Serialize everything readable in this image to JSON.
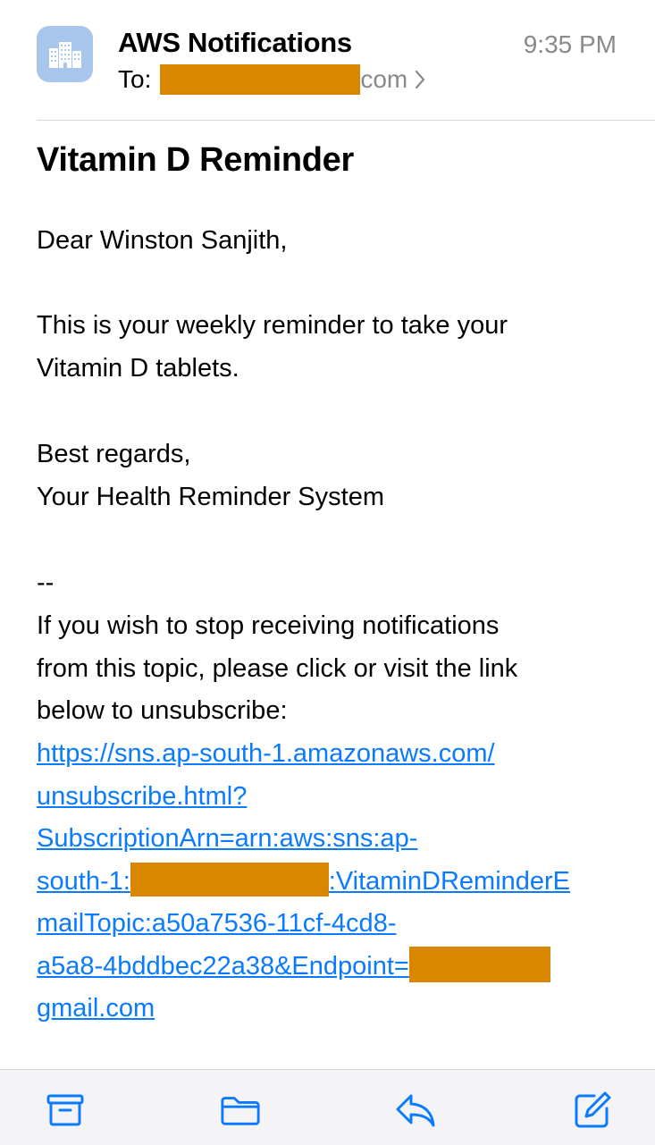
{
  "header": {
    "sender": "AWS Notifications",
    "time": "9:35 PM",
    "to_label": "To:",
    "to_suffix": "com",
    "avatar_icon": "building-icon",
    "redaction_color": "#d98600"
  },
  "email": {
    "subject": "Vitamin D Reminder",
    "greeting": "Dear Winston Sanjith,",
    "paragraph_1_lines": [
      "This is your weekly reminder to take your",
      "Vitamin D tablets."
    ],
    "closing_lines": [
      "Best regards,",
      "Your Health Reminder System"
    ],
    "separator": "--",
    "unsubscribe_lines": [
      "If you wish to stop receiving notifications",
      "from this topic, please click or visit the link",
      "below to unsubscribe:"
    ],
    "link": {
      "line_1": "https://sns.ap-south-1.amazonaws.com/",
      "line_2": "unsubscribe.html?",
      "line_3": "SubscriptionArn=arn:aws:sns:ap-",
      "line_4_start": "south-1:",
      "line_4_end": ":VitaminDReminderE",
      "line_5": "mailTopic:a50a7536-11cf-4cd8-",
      "line_6": "a5a8-4bddbec22a38&Endpoint=",
      "line_7": "gmail.com",
      "color": "#0a7aff"
    }
  },
  "toolbar": {
    "icons": [
      "archive-icon",
      "folder-icon",
      "reply-icon",
      "compose-icon"
    ],
    "accent": "#0a7aff"
  }
}
